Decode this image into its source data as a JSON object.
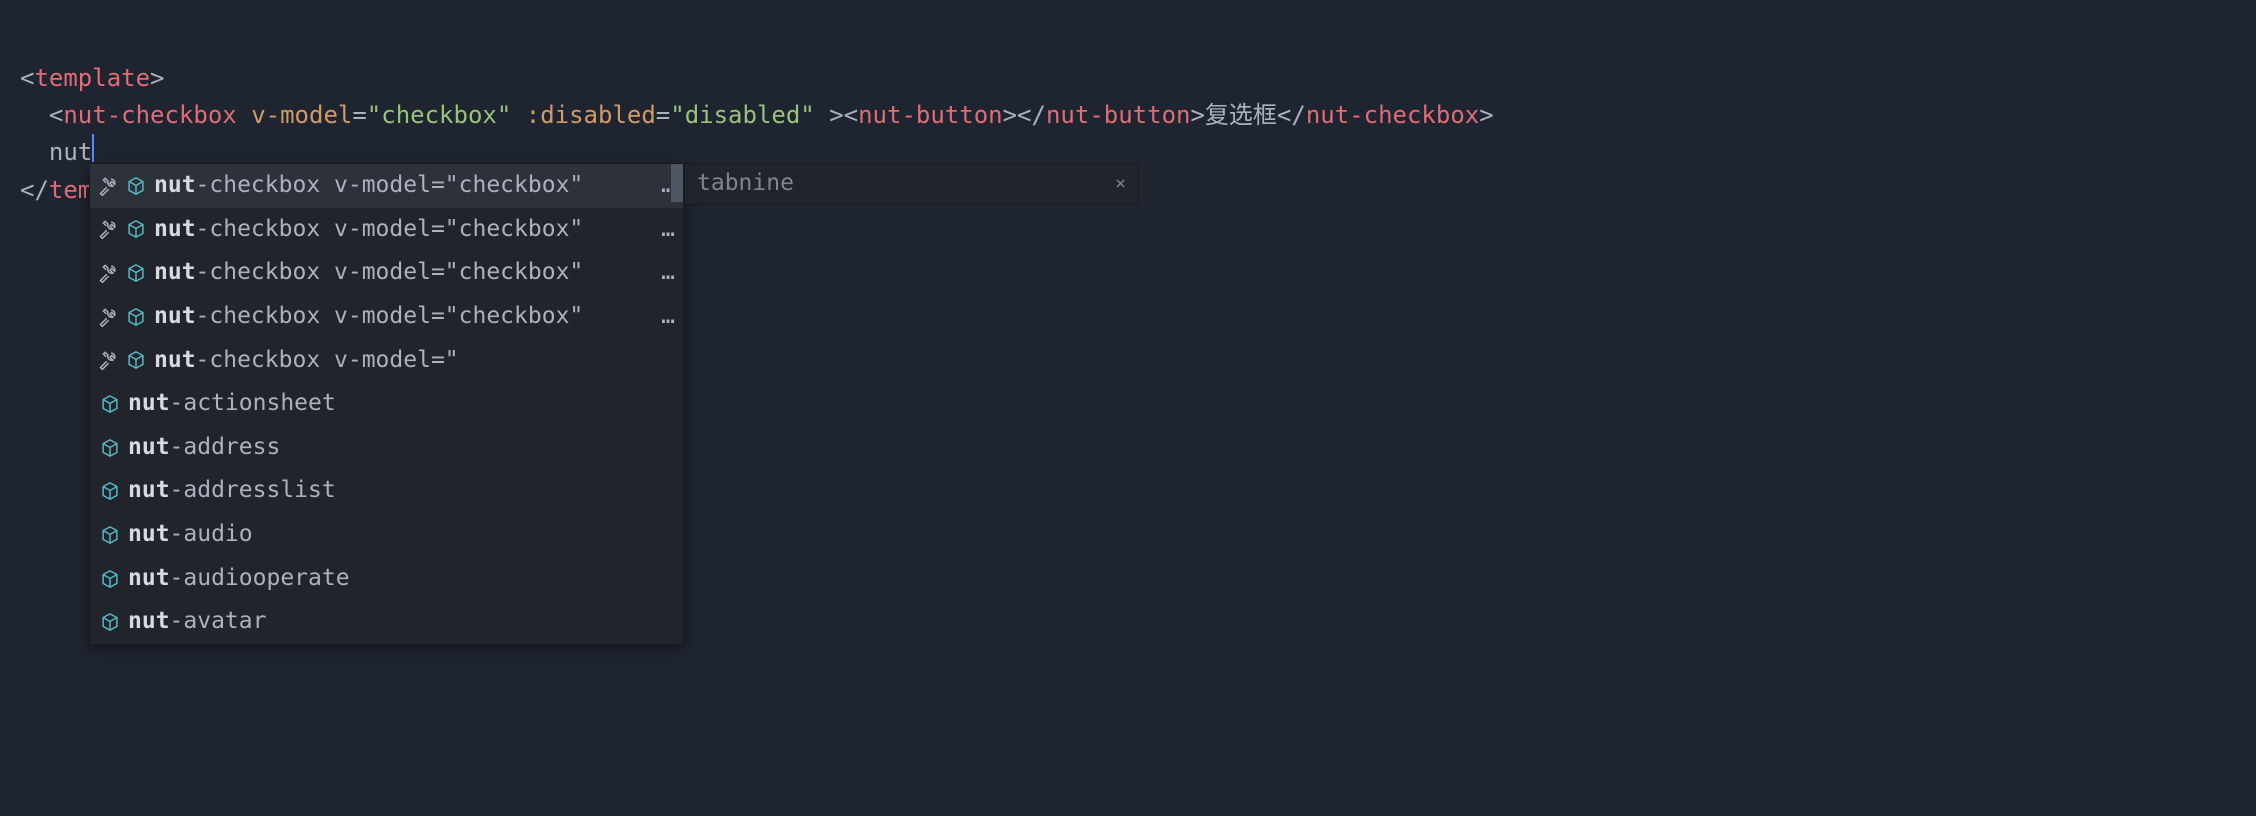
{
  "code": {
    "line1": {
      "open_bracket": "<",
      "tag": "template",
      "close_bracket": ">"
    },
    "line2": {
      "indent": "  ",
      "open_bracket": "<",
      "tag1": "nut-checkbox",
      "attr1_name": " v-model",
      "attr1_eq": "=",
      "attr1_val": "\"checkbox\"",
      "attr2_name": " :disabled",
      "attr2_eq": "=",
      "attr2_val": "\"disabled\"",
      "mid_bracket": " ><",
      "tag2": "nut-button",
      "mid_bracket2": "></",
      "tag2_close": "nut-button",
      "close_bracket2": ">",
      "text": "复选框",
      "close_open": "</",
      "tag1_close": "nut-checkbox",
      "final_bracket": ">"
    },
    "line3": {
      "indent": "  ",
      "typed": "nut"
    },
    "line4": {
      "open_bracket": "</",
      "tag": "tem"
    }
  },
  "autocomplete": {
    "items": [
      {
        "bold": "nut",
        "rest": "-checkbox v-model=\"checkbox\"",
        "ellipsis": "…",
        "icons": "wrench-cube"
      },
      {
        "bold": "nut",
        "rest": "-checkbox v-model=\"checkbox\"",
        "ellipsis": "…",
        "icons": "wrench-cube"
      },
      {
        "bold": "nut",
        "rest": "-checkbox v-model=\"checkbox\"",
        "ellipsis": "…",
        "icons": "wrench-cube"
      },
      {
        "bold": "nut",
        "rest": "-checkbox v-model=\"checkbox\"",
        "ellipsis": "…",
        "icons": "wrench-cube"
      },
      {
        "bold": "nut",
        "rest": "-checkbox v-model=\"",
        "ellipsis": "",
        "icons": "wrench-cube"
      },
      {
        "bold": "nut",
        "rest": "-actionsheet",
        "ellipsis": "",
        "icons": "cube"
      },
      {
        "bold": "nut",
        "rest": "-address",
        "ellipsis": "",
        "icons": "cube"
      },
      {
        "bold": "nut",
        "rest": "-addresslist",
        "ellipsis": "",
        "icons": "cube"
      },
      {
        "bold": "nut",
        "rest": "-audio",
        "ellipsis": "",
        "icons": "cube"
      },
      {
        "bold": "nut",
        "rest": "-audiooperate",
        "ellipsis": "",
        "icons": "cube"
      },
      {
        "bold": "nut",
        "rest": "-avatar",
        "ellipsis": "",
        "icons": "cube"
      }
    ]
  },
  "detail": {
    "label": "tabnine",
    "close": "×"
  }
}
